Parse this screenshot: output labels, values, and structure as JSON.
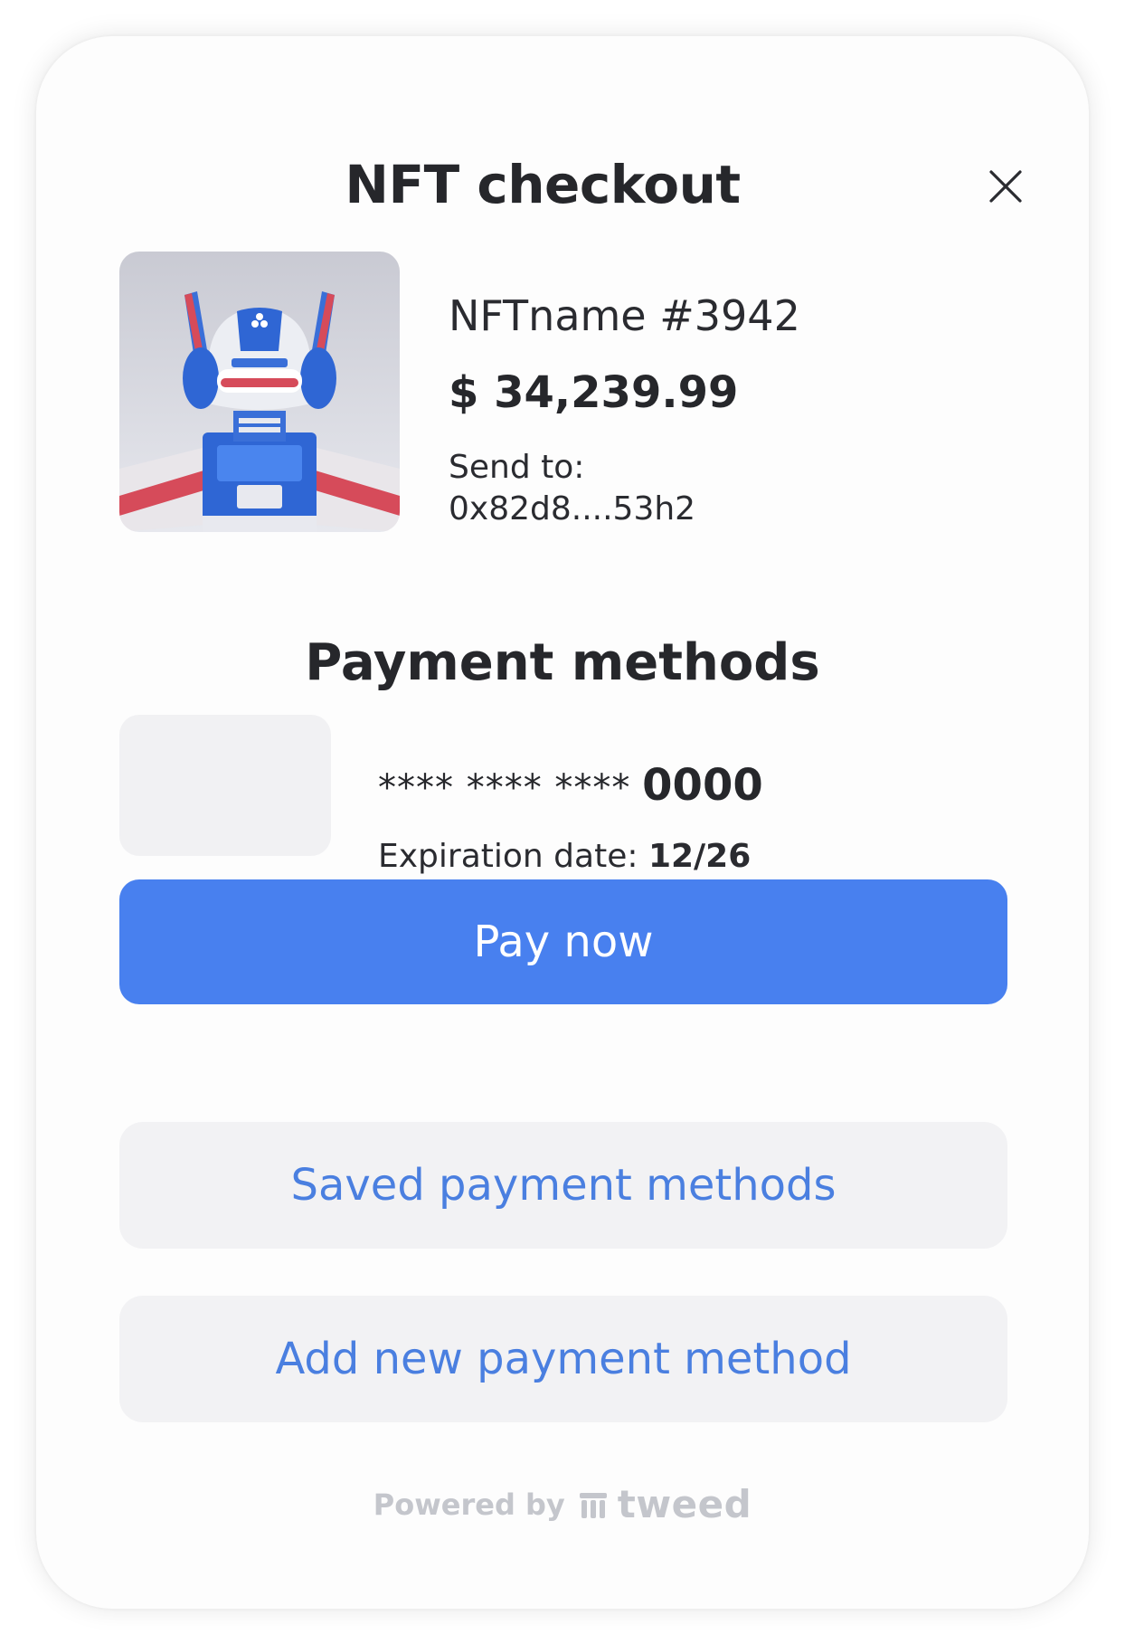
{
  "header": {
    "title": "NFT checkout"
  },
  "nft": {
    "name": "NFTname #3942",
    "price": "$ 34,239.99",
    "send_label": "Send to:",
    "send_address": "0x82d8....53h2"
  },
  "payment": {
    "section_title": "Payment methods",
    "card_mask": "**** **** ****",
    "card_last4": "0000",
    "exp_label": "Expiration date:",
    "exp_value": "12/26",
    "pay_label": "Pay now",
    "saved_label": "Saved payment methods",
    "add_label": "Add new payment method"
  },
  "footer": {
    "powered_by": "Powered by",
    "brand": "tweed"
  },
  "colors": {
    "primary": "#4880ef",
    "link": "#4a7fe0",
    "secondary_bg": "#f2f2f4",
    "footer_text": "#c4c6cc"
  },
  "icons": {
    "close": "close-icon",
    "brand_logo": "tweed-logo-icon"
  }
}
